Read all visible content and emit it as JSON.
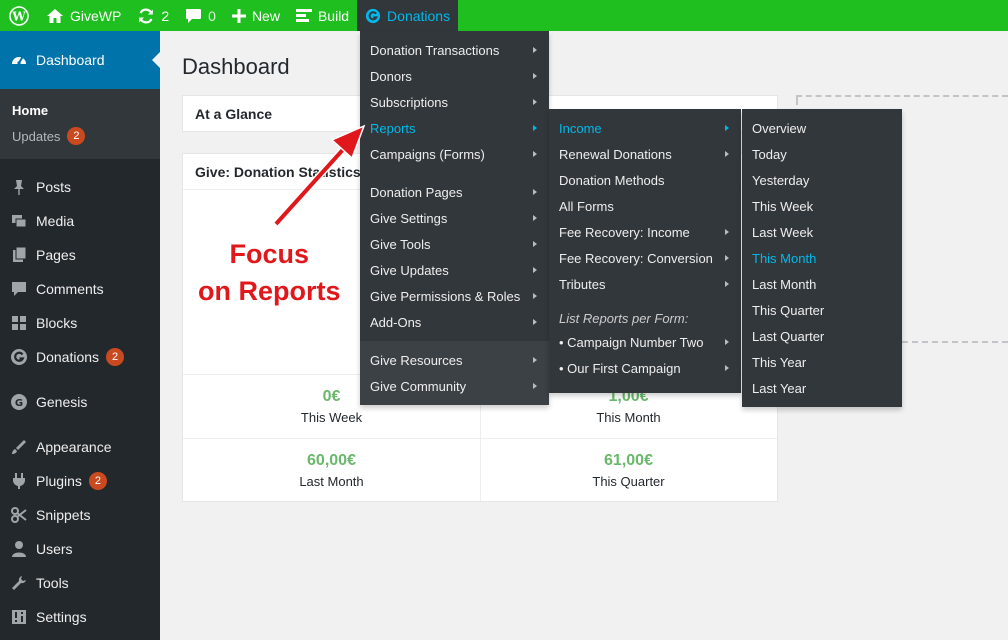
{
  "adminbar": {
    "site_name": "GiveWP",
    "updates_count": "2",
    "comments_count": "0",
    "new_label": "New",
    "build_label": "Build",
    "donations_label": "Donations"
  },
  "sidebar": {
    "dashboard_label": "Dashboard",
    "home_label": "Home",
    "updates_label": "Updates",
    "updates_badge": "2",
    "items": [
      {
        "label": "Posts",
        "icon": "pin-icon"
      },
      {
        "label": "Media",
        "icon": "media-icon"
      },
      {
        "label": "Pages",
        "icon": "pages-icon"
      },
      {
        "label": "Comments",
        "icon": "comment-icon"
      },
      {
        "label": "Blocks",
        "icon": "blocks-icon"
      },
      {
        "label": "Donations",
        "icon": "give-icon",
        "badge": "2"
      },
      {
        "label": "Genesis",
        "icon": "genesis-icon"
      },
      {
        "label": "Appearance",
        "icon": "brush-icon"
      },
      {
        "label": "Plugins",
        "icon": "plugin-icon",
        "badge": "2"
      },
      {
        "label": "Snippets",
        "icon": "scissors-icon"
      },
      {
        "label": "Users",
        "icon": "user-icon"
      },
      {
        "label": "Tools",
        "icon": "wrench-icon"
      },
      {
        "label": "Settings",
        "icon": "settings-icon"
      }
    ]
  },
  "main": {
    "title": "Dashboard",
    "glance_title": "At a Glance",
    "stats_title": "Give: Donation Statistics",
    "stats": [
      {
        "value": "0€",
        "label": "This Week"
      },
      {
        "value": "1,00€",
        "label": "This Month"
      },
      {
        "value": "60,00€",
        "label": "Last Month"
      },
      {
        "value": "61,00€",
        "label": "This Quarter"
      }
    ]
  },
  "menu_donations": {
    "group1": [
      "Donation Transactions",
      "Donors",
      "Subscriptions",
      "Reports",
      "Campaigns (Forms)"
    ],
    "group2": [
      "Donation Pages",
      "Give Settings",
      "Give Tools",
      "Give Updates",
      "Give Permissions & Roles",
      "Add-Ons"
    ],
    "group3": [
      "Give Resources",
      "Give Community"
    ]
  },
  "menu_reports": {
    "items": [
      "Income",
      "Renewal Donations",
      "Donation Methods",
      "All Forms",
      "Fee Recovery: Income",
      "Fee Recovery: Conversion",
      "Tributes"
    ],
    "per_form_heading": "List Reports per Form:",
    "forms": [
      "• Campaign Number Two",
      "• Our First Campaign"
    ]
  },
  "menu_income": {
    "items": [
      "Overview",
      "Today",
      "Yesterday",
      "This Week",
      "Last Week",
      "This Month",
      "Last Month",
      "This Quarter",
      "Last Quarter",
      "This Year",
      "Last Year"
    ]
  },
  "annotation": {
    "line1": "Focus",
    "line2": "on Reports",
    "color": "#e0181c"
  },
  "colors": {
    "adminbar": "#1fbf1f",
    "sidebar": "#23282d",
    "active_blue": "#0073aa",
    "highlight": "#00b9eb",
    "stat_green": "#69b86b"
  }
}
